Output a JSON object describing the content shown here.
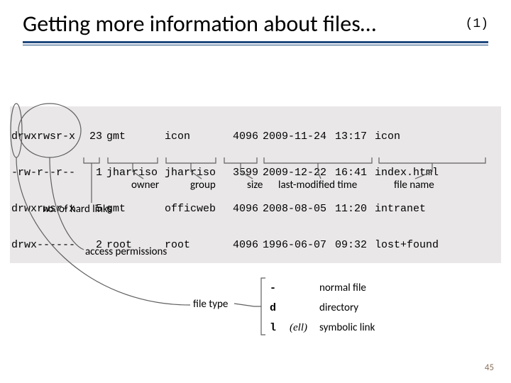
{
  "title": "Getting more information about files…",
  "paren": "(1)",
  "listing": [
    {
      "perm": "drwxrwsr-x",
      "links": "23",
      "owner": "gmt",
      "group": "icon",
      "size": "4096",
      "date": "2009-11-24",
      "time": "13:17",
      "name": "icon"
    },
    {
      "perm": "-rw-r--r--",
      "links": "1",
      "owner": "jharriso",
      "group": "jharriso",
      "size": "3599",
      "date": "2009-12-22",
      "time": "16:41",
      "name": "index.html"
    },
    {
      "perm": "drwxrwsr-x",
      "links": "5",
      "owner": "gmt",
      "group": "officweb",
      "size": "4096",
      "date": "2008-08-05",
      "time": "11:20",
      "name": "intranet"
    },
    {
      "perm": "drwx------",
      "links": "2",
      "owner": "root",
      "group": "root",
      "size": "4096",
      "date": "1996-06-07",
      "time": "09:32",
      "name": "lost+found"
    }
  ],
  "labels": {
    "owner": "owner",
    "group": "group",
    "size": "size",
    "lastmod": "last-modified time",
    "filename": "file name",
    "hardlinks": "no. of hard links",
    "accessperm": "access permissions",
    "filetype": "file type"
  },
  "filetype_key": [
    {
      "sym": "-",
      "ell": "",
      "desc": "normal file"
    },
    {
      "sym": "d",
      "ell": "",
      "desc": "directory"
    },
    {
      "sym": "l",
      "ell": "(ell)",
      "desc": "symbolic link"
    }
  ],
  "slide_no": "45"
}
